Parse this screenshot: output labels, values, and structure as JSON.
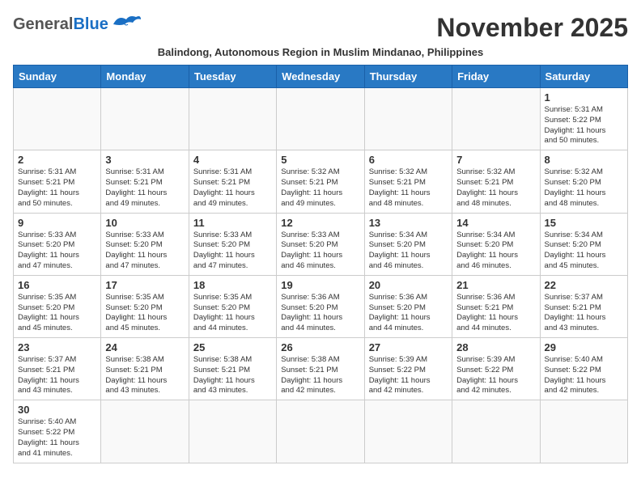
{
  "header": {
    "logo_general": "General",
    "logo_blue": "Blue",
    "month_title": "November 2025",
    "subtitle": "Balindong, Autonomous Region in Muslim Mindanao, Philippines"
  },
  "weekdays": [
    "Sunday",
    "Monday",
    "Tuesday",
    "Wednesday",
    "Thursday",
    "Friday",
    "Saturday"
  ],
  "weeks": [
    [
      {
        "day": "",
        "info": ""
      },
      {
        "day": "",
        "info": ""
      },
      {
        "day": "",
        "info": ""
      },
      {
        "day": "",
        "info": ""
      },
      {
        "day": "",
        "info": ""
      },
      {
        "day": "",
        "info": ""
      },
      {
        "day": "1",
        "info": "Sunrise: 5:31 AM\nSunset: 5:22 PM\nDaylight: 11 hours\nand 50 minutes."
      }
    ],
    [
      {
        "day": "2",
        "info": "Sunrise: 5:31 AM\nSunset: 5:21 PM\nDaylight: 11 hours\nand 50 minutes."
      },
      {
        "day": "3",
        "info": "Sunrise: 5:31 AM\nSunset: 5:21 PM\nDaylight: 11 hours\nand 49 minutes."
      },
      {
        "day": "4",
        "info": "Sunrise: 5:31 AM\nSunset: 5:21 PM\nDaylight: 11 hours\nand 49 minutes."
      },
      {
        "day": "5",
        "info": "Sunrise: 5:32 AM\nSunset: 5:21 PM\nDaylight: 11 hours\nand 49 minutes."
      },
      {
        "day": "6",
        "info": "Sunrise: 5:32 AM\nSunset: 5:21 PM\nDaylight: 11 hours\nand 48 minutes."
      },
      {
        "day": "7",
        "info": "Sunrise: 5:32 AM\nSunset: 5:21 PM\nDaylight: 11 hours\nand 48 minutes."
      },
      {
        "day": "8",
        "info": "Sunrise: 5:32 AM\nSunset: 5:20 PM\nDaylight: 11 hours\nand 48 minutes."
      }
    ],
    [
      {
        "day": "9",
        "info": "Sunrise: 5:33 AM\nSunset: 5:20 PM\nDaylight: 11 hours\nand 47 minutes."
      },
      {
        "day": "10",
        "info": "Sunrise: 5:33 AM\nSunset: 5:20 PM\nDaylight: 11 hours\nand 47 minutes."
      },
      {
        "day": "11",
        "info": "Sunrise: 5:33 AM\nSunset: 5:20 PM\nDaylight: 11 hours\nand 47 minutes."
      },
      {
        "day": "12",
        "info": "Sunrise: 5:33 AM\nSunset: 5:20 PM\nDaylight: 11 hours\nand 46 minutes."
      },
      {
        "day": "13",
        "info": "Sunrise: 5:34 AM\nSunset: 5:20 PM\nDaylight: 11 hours\nand 46 minutes."
      },
      {
        "day": "14",
        "info": "Sunrise: 5:34 AM\nSunset: 5:20 PM\nDaylight: 11 hours\nand 46 minutes."
      },
      {
        "day": "15",
        "info": "Sunrise: 5:34 AM\nSunset: 5:20 PM\nDaylight: 11 hours\nand 45 minutes."
      }
    ],
    [
      {
        "day": "16",
        "info": "Sunrise: 5:35 AM\nSunset: 5:20 PM\nDaylight: 11 hours\nand 45 minutes."
      },
      {
        "day": "17",
        "info": "Sunrise: 5:35 AM\nSunset: 5:20 PM\nDaylight: 11 hours\nand 45 minutes."
      },
      {
        "day": "18",
        "info": "Sunrise: 5:35 AM\nSunset: 5:20 PM\nDaylight: 11 hours\nand 44 minutes."
      },
      {
        "day": "19",
        "info": "Sunrise: 5:36 AM\nSunset: 5:20 PM\nDaylight: 11 hours\nand 44 minutes."
      },
      {
        "day": "20",
        "info": "Sunrise: 5:36 AM\nSunset: 5:20 PM\nDaylight: 11 hours\nand 44 minutes."
      },
      {
        "day": "21",
        "info": "Sunrise: 5:36 AM\nSunset: 5:21 PM\nDaylight: 11 hours\nand 44 minutes."
      },
      {
        "day": "22",
        "info": "Sunrise: 5:37 AM\nSunset: 5:21 PM\nDaylight: 11 hours\nand 43 minutes."
      }
    ],
    [
      {
        "day": "23",
        "info": "Sunrise: 5:37 AM\nSunset: 5:21 PM\nDaylight: 11 hours\nand 43 minutes."
      },
      {
        "day": "24",
        "info": "Sunrise: 5:38 AM\nSunset: 5:21 PM\nDaylight: 11 hours\nand 43 minutes."
      },
      {
        "day": "25",
        "info": "Sunrise: 5:38 AM\nSunset: 5:21 PM\nDaylight: 11 hours\nand 43 minutes."
      },
      {
        "day": "26",
        "info": "Sunrise: 5:38 AM\nSunset: 5:21 PM\nDaylight: 11 hours\nand 42 minutes."
      },
      {
        "day": "27",
        "info": "Sunrise: 5:39 AM\nSunset: 5:22 PM\nDaylight: 11 hours\nand 42 minutes."
      },
      {
        "day": "28",
        "info": "Sunrise: 5:39 AM\nSunset: 5:22 PM\nDaylight: 11 hours\nand 42 minutes."
      },
      {
        "day": "29",
        "info": "Sunrise: 5:40 AM\nSunset: 5:22 PM\nDaylight: 11 hours\nand 42 minutes."
      }
    ],
    [
      {
        "day": "30",
        "info": "Sunrise: 5:40 AM\nSunset: 5:22 PM\nDaylight: 11 hours\nand 41 minutes."
      },
      {
        "day": "",
        "info": ""
      },
      {
        "day": "",
        "info": ""
      },
      {
        "day": "",
        "info": ""
      },
      {
        "day": "",
        "info": ""
      },
      {
        "day": "",
        "info": ""
      },
      {
        "day": "",
        "info": ""
      }
    ]
  ]
}
